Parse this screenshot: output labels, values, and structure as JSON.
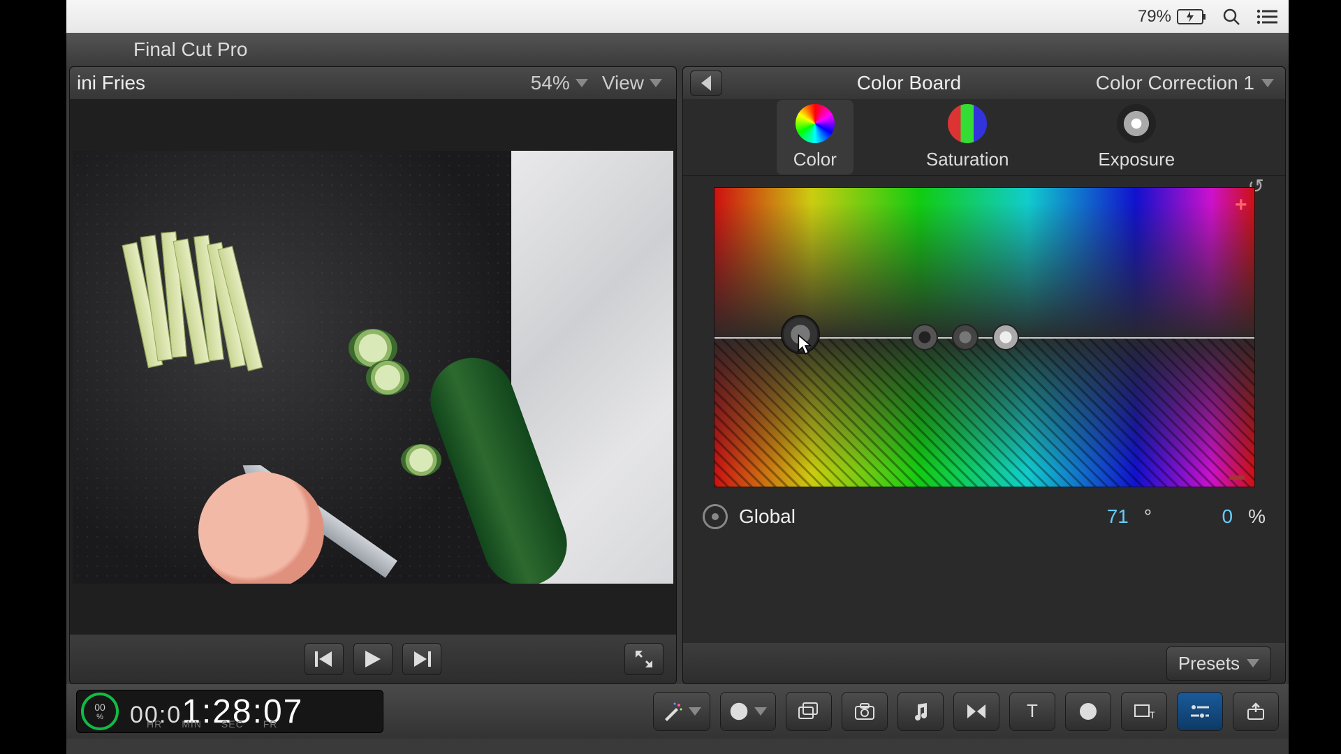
{
  "menubar": {
    "battery_pct": "79%"
  },
  "app": {
    "name": "Final Cut Pro"
  },
  "viewer": {
    "clip_title": "ini Fries",
    "zoom": "54%",
    "view_label": "View"
  },
  "inspector": {
    "title": "Color Board",
    "correction_name": "Color Correction 1",
    "tabs": {
      "color": "Color",
      "saturation": "Saturation",
      "exposure": "Exposure"
    },
    "active_tab": "color",
    "selected_puck": "Global",
    "hue_value": "71",
    "hue_unit": "°",
    "pct_value": "0",
    "pct_unit": "%",
    "presets_label": "Presets"
  },
  "timecode": {
    "dial_top": "00",
    "dial_bottom": "%",
    "prefix": "00:0",
    "main": "1:28:07",
    "labels": [
      "HR",
      "MIN",
      "SEC",
      "FR"
    ]
  }
}
